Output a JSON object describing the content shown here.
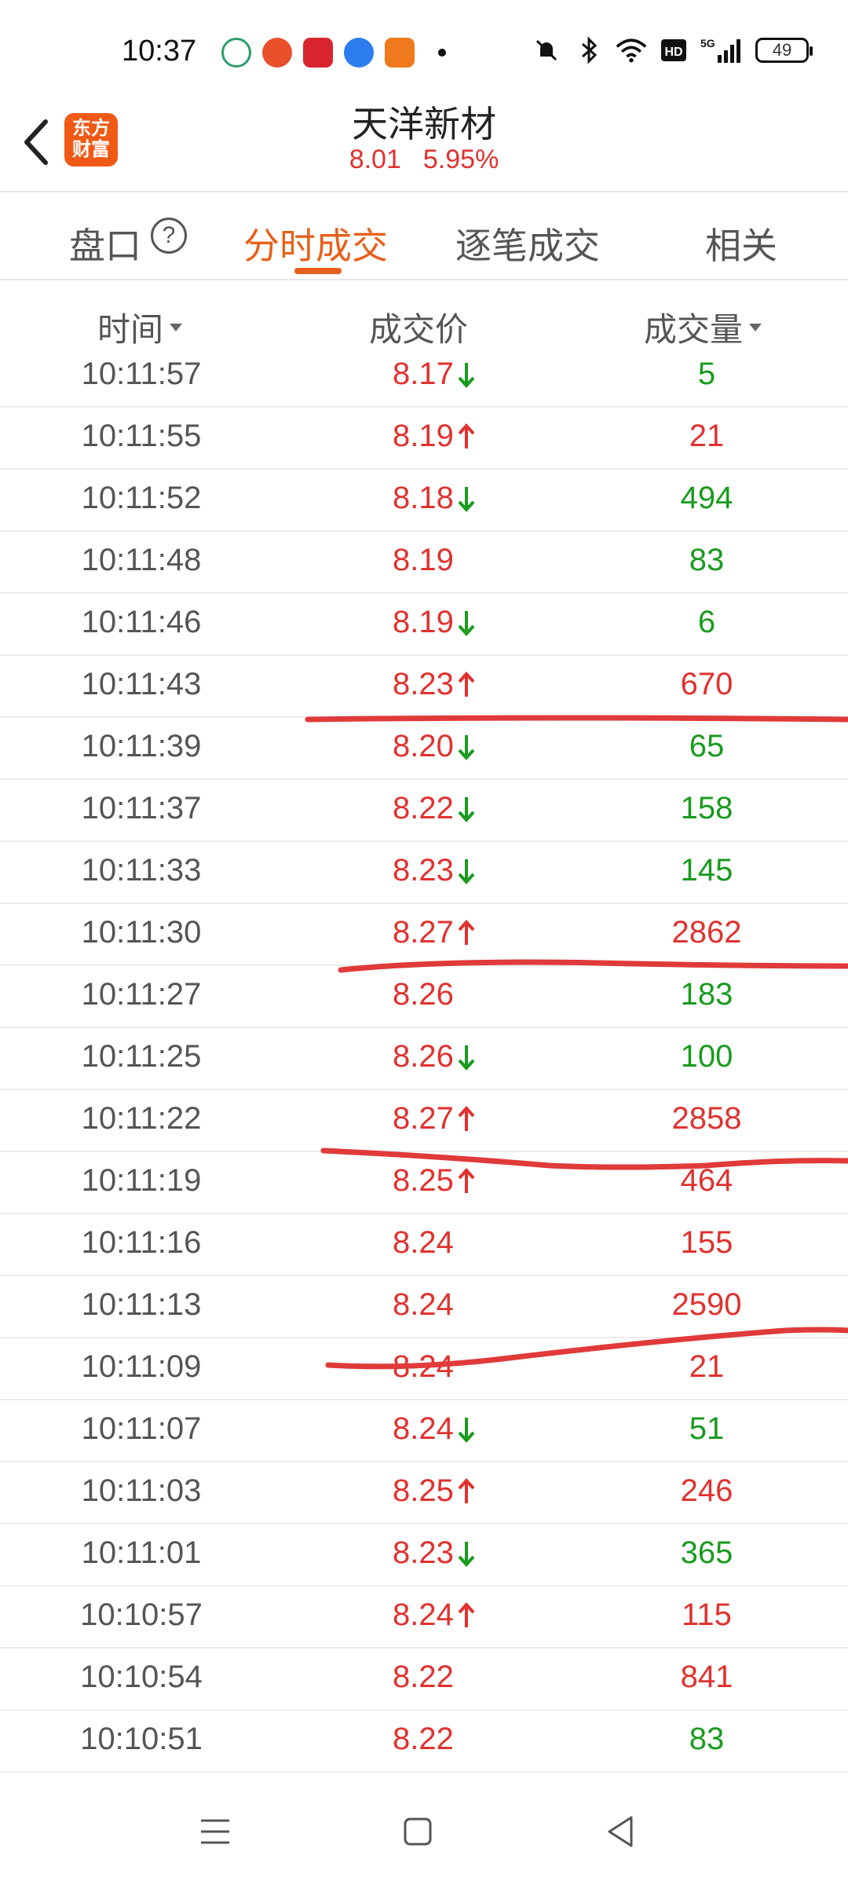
{
  "status_bar": {
    "time": "10:37",
    "battery": "49",
    "network": "5G"
  },
  "header": {
    "logo_text": "东方财富",
    "stock_name": "天洋新材",
    "price": "8.01",
    "change_pct": "5.95%"
  },
  "tabs": [
    {
      "label": "盘口"
    },
    {
      "label": "分时成交"
    },
    {
      "label": "逐笔成交"
    },
    {
      "label": "相关"
    }
  ],
  "columns": {
    "time": "时间",
    "price": "成交价",
    "volume": "成交量"
  },
  "trades": [
    {
      "time": "10:11:57",
      "price": "8.17",
      "dir": "down",
      "volume": "5",
      "vol_color": "green"
    },
    {
      "time": "10:11:55",
      "price": "8.19",
      "dir": "up",
      "volume": "21",
      "vol_color": "red"
    },
    {
      "time": "10:11:52",
      "price": "8.18",
      "dir": "down",
      "volume": "494",
      "vol_color": "green"
    },
    {
      "time": "10:11:48",
      "price": "8.19",
      "dir": "none",
      "volume": "83",
      "vol_color": "green"
    },
    {
      "time": "10:11:46",
      "price": "8.19",
      "dir": "down",
      "volume": "6",
      "vol_color": "green"
    },
    {
      "time": "10:11:43",
      "price": "8.23",
      "dir": "up",
      "volume": "670",
      "vol_color": "red"
    },
    {
      "time": "10:11:39",
      "price": "8.20",
      "dir": "down",
      "volume": "65",
      "vol_color": "green"
    },
    {
      "time": "10:11:37",
      "price": "8.22",
      "dir": "down",
      "volume": "158",
      "vol_color": "green"
    },
    {
      "time": "10:11:33",
      "price": "8.23",
      "dir": "down",
      "volume": "145",
      "vol_color": "green"
    },
    {
      "time": "10:11:30",
      "price": "8.27",
      "dir": "up",
      "volume": "2862",
      "vol_color": "red"
    },
    {
      "time": "10:11:27",
      "price": "8.26",
      "dir": "none",
      "volume": "183",
      "vol_color": "green"
    },
    {
      "time": "10:11:25",
      "price": "8.26",
      "dir": "down",
      "volume": "100",
      "vol_color": "green"
    },
    {
      "time": "10:11:22",
      "price": "8.27",
      "dir": "up",
      "volume": "2858",
      "vol_color": "red"
    },
    {
      "time": "10:11:19",
      "price": "8.25",
      "dir": "up",
      "volume": "464",
      "vol_color": "red"
    },
    {
      "time": "10:11:16",
      "price": "8.24",
      "dir": "none",
      "volume": "155",
      "vol_color": "red"
    },
    {
      "time": "10:11:13",
      "price": "8.24",
      "dir": "none",
      "volume": "2590",
      "vol_color": "red"
    },
    {
      "time": "10:11:09",
      "price": "8.24",
      "dir": "none",
      "volume": "21",
      "vol_color": "red"
    },
    {
      "time": "10:11:07",
      "price": "8.24",
      "dir": "down",
      "volume": "51",
      "vol_color": "green"
    },
    {
      "time": "10:11:03",
      "price": "8.25",
      "dir": "up",
      "volume": "246",
      "vol_color": "red"
    },
    {
      "time": "10:11:01",
      "price": "8.23",
      "dir": "down",
      "volume": "365",
      "vol_color": "green"
    },
    {
      "time": "10:10:57",
      "price": "8.24",
      "dir": "up",
      "volume": "115",
      "vol_color": "red"
    },
    {
      "time": "10:10:54",
      "price": "8.22",
      "dir": "none",
      "volume": "841",
      "vol_color": "red"
    },
    {
      "time": "10:10:51",
      "price": "8.22",
      "dir": "none",
      "volume": "83",
      "vol_color": "green"
    }
  ],
  "colors": {
    "up": "#e0322f",
    "down": "#199b1e",
    "accent": "#e6601b",
    "annotation": "#e03a3a"
  }
}
